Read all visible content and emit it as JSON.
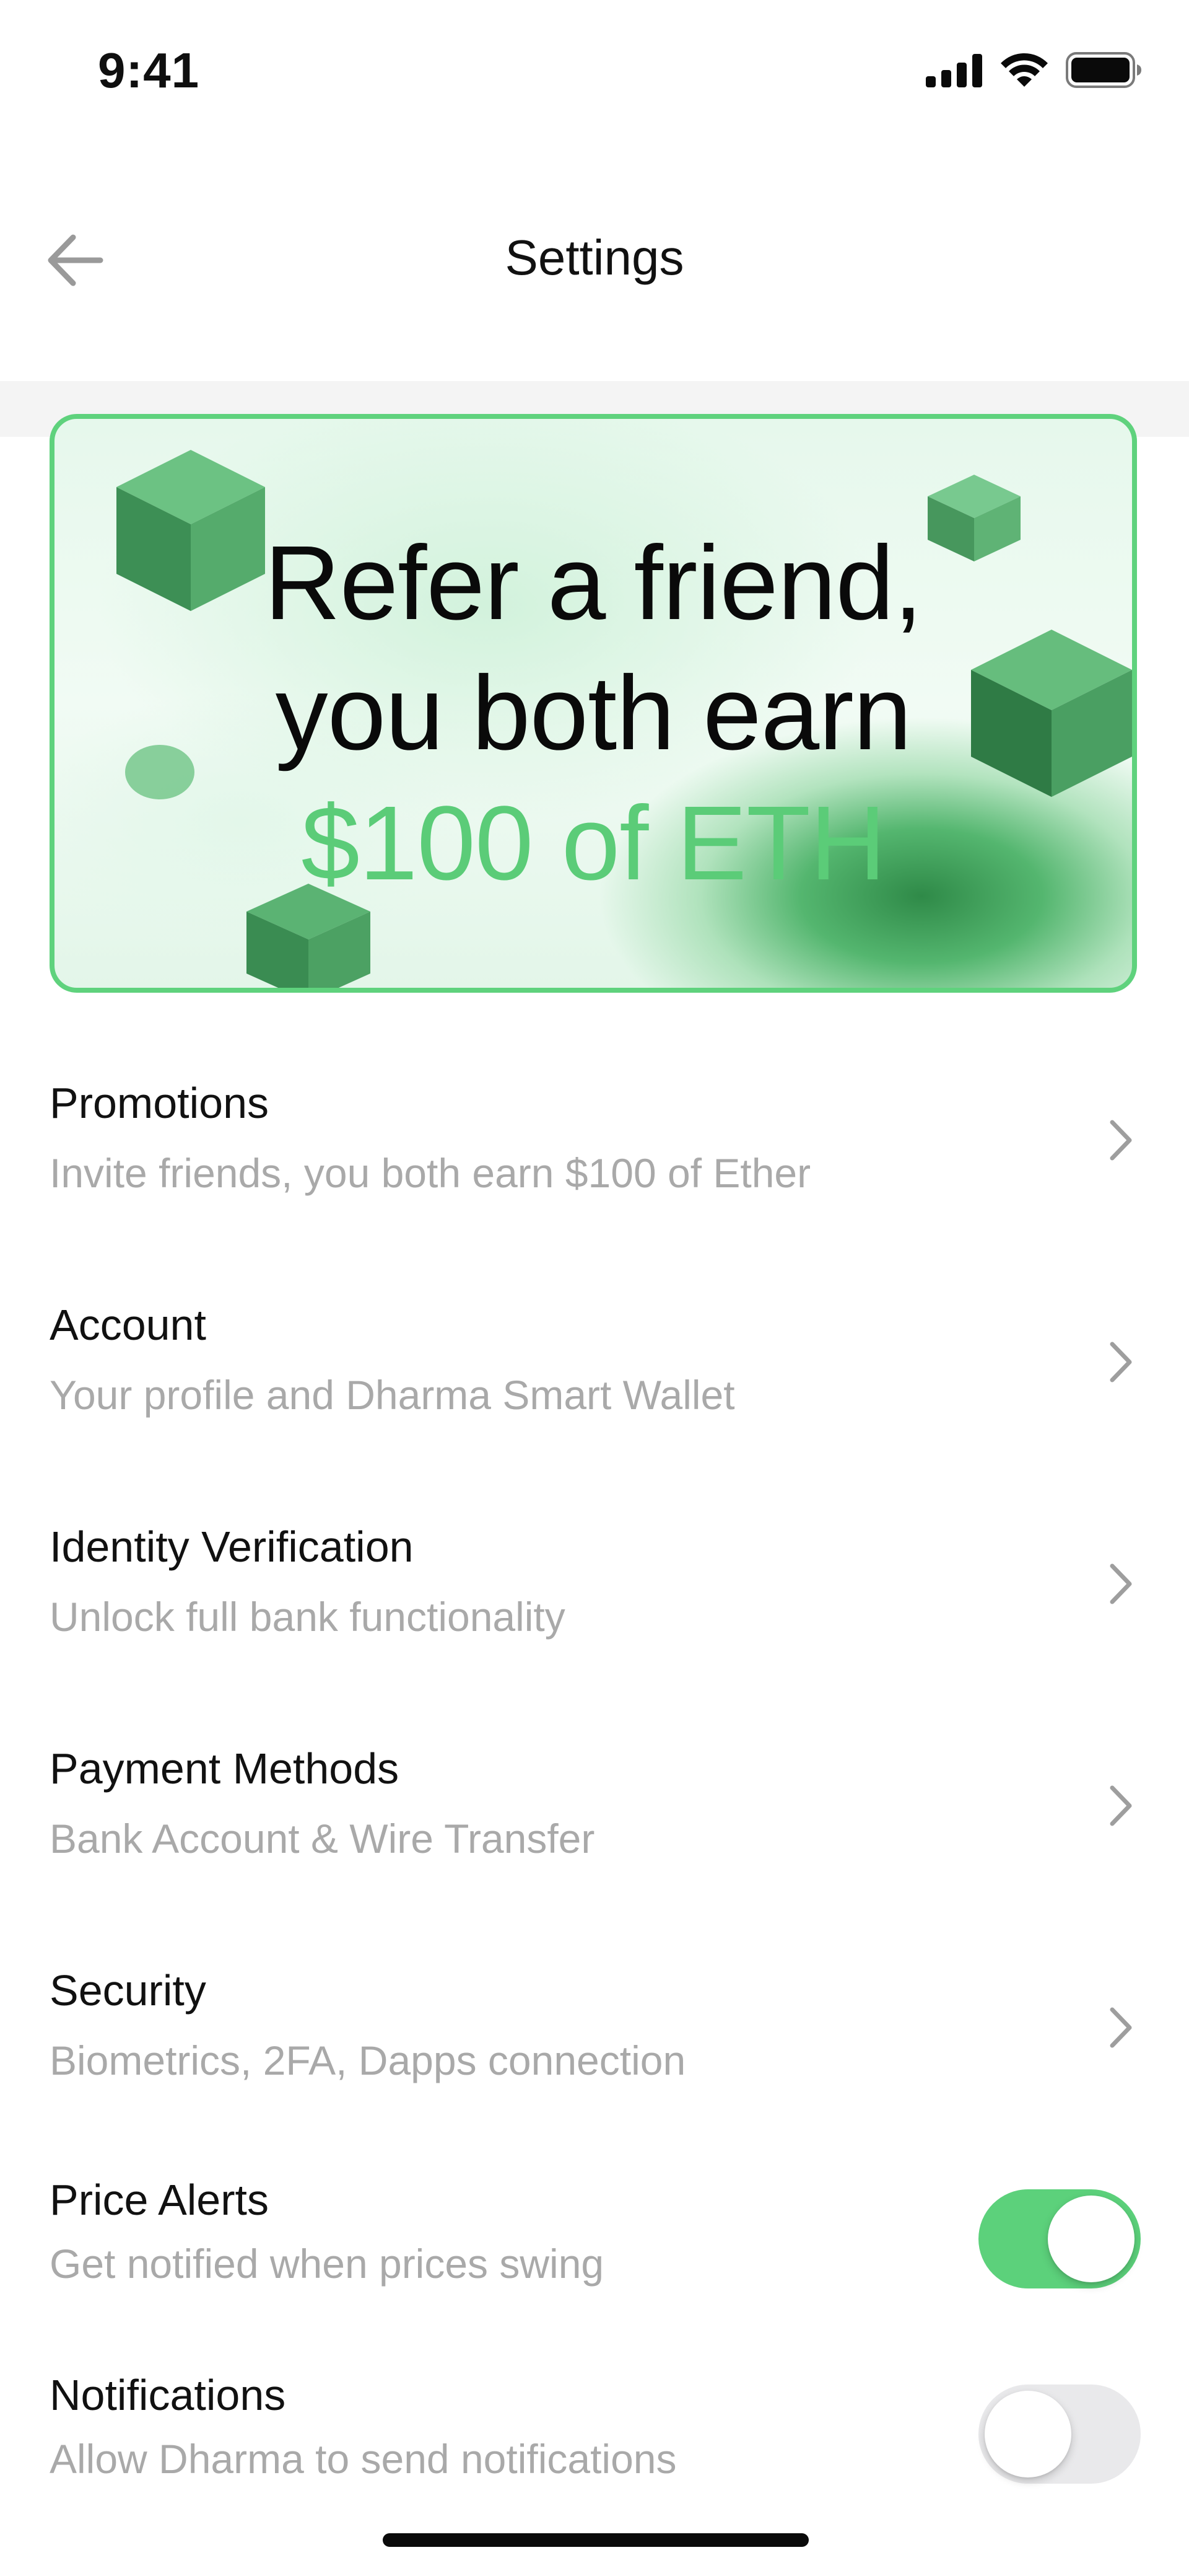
{
  "status_bar": {
    "time": "9:41"
  },
  "nav": {
    "title": "Settings"
  },
  "banner": {
    "line1": "Refer a friend,",
    "line2": "you both earn",
    "line3": "$100 of ETH",
    "accent_color": "#5bcc78",
    "border_color": "#5fd27d"
  },
  "items": [
    {
      "title": "Promotions",
      "subtitle": "Invite friends, you both earn $100 of Ether",
      "control": "chevron"
    },
    {
      "title": "Account",
      "subtitle": "Your profile and Dharma Smart Wallet",
      "control": "chevron"
    },
    {
      "title": "Identity Verification",
      "subtitle": "Unlock full bank functionality",
      "control": "chevron"
    },
    {
      "title": "Payment Methods",
      "subtitle": "Bank Account & Wire Transfer",
      "control": "chevron"
    },
    {
      "title": "Security",
      "subtitle": "Biometrics, 2FA, Dapps connection",
      "control": "chevron"
    },
    {
      "title": "Price Alerts",
      "subtitle": "Get notified when prices swing",
      "control": "toggle",
      "checked": true
    },
    {
      "title": "Notifications",
      "subtitle": "Allow Dharma to send notifications",
      "control": "toggle",
      "checked": false
    }
  ],
  "colors": {
    "toggle_on": "#5cd17b",
    "toggle_off": "#e9e9eb",
    "subtitle": "#a9a9a9",
    "chevron": "#9e9e9e"
  },
  "icons": {
    "back": "arrow-left-icon",
    "chevron": "chevron-right-icon",
    "signal": "cellular-signal-icon",
    "wifi": "wifi-icon",
    "battery": "battery-icon"
  }
}
